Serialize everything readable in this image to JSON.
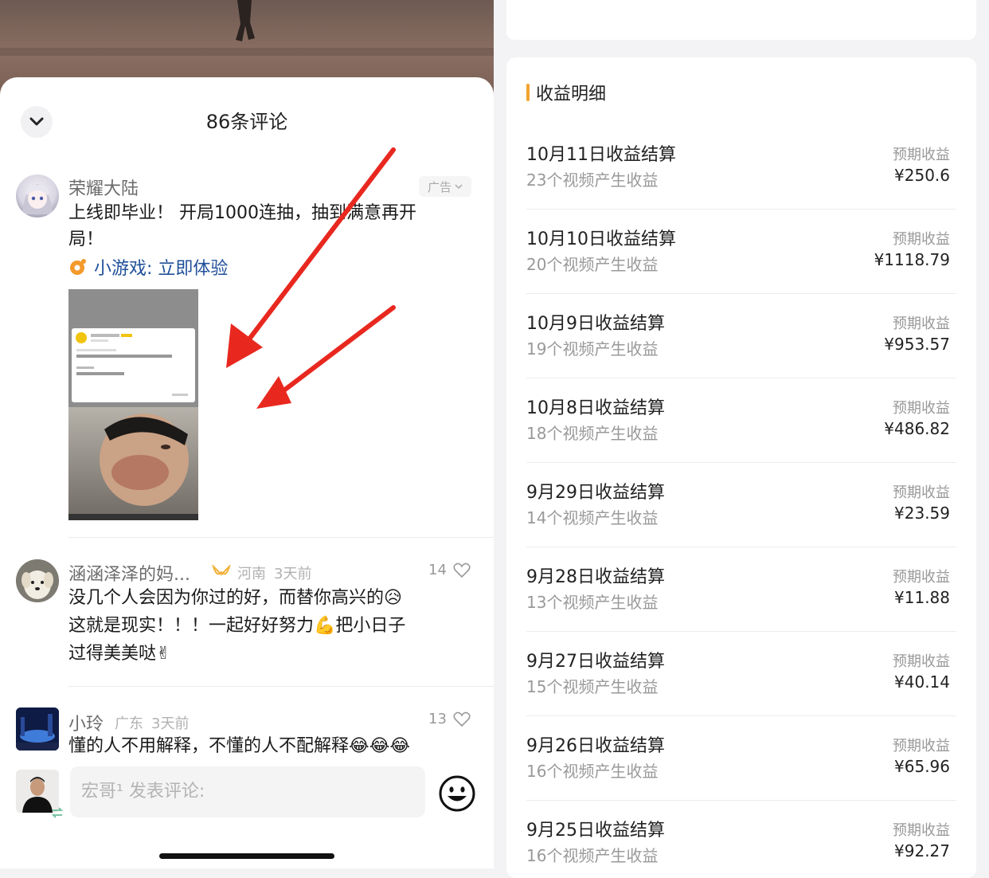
{
  "comments_panel": {
    "title": "86条评论",
    "ad_comment": {
      "username": "荣耀大陆",
      "ad_label": "广告",
      "text_line1": "上线即毕业！ 开局1000连抽，抽到满意再开",
      "text_line2": "局！",
      "game_link": "小游戏: 立即体验"
    },
    "comments": [
      {
        "username": "涵涵泽泽的妈...",
        "location": "河南",
        "time": "3天前",
        "likes": "14",
        "line1": "没几个人会因为你过的好，而替你高兴的😥",
        "line2": "这就是现实！！！一起好好努力💪把小日子",
        "line3": "过得美美哒✌"
      },
      {
        "username": "小玲",
        "location": "广东",
        "time": "3天前",
        "likes": "13",
        "line1": "懂的人不用解释，不懂的人不配解释😂😂😂"
      }
    ],
    "input": {
      "placeholder": "宏哥¹ 发表评论:"
    }
  },
  "earnings": {
    "title": "收益明细",
    "accent_color": "#f2a32f",
    "items": [
      {
        "title": "10月11日收益结算",
        "sub": "23个视频产生收益",
        "label": "预期收益",
        "amount": "¥250.6"
      },
      {
        "title": "10月10日收益结算",
        "sub": "20个视频产生收益",
        "label": "预期收益",
        "amount": "¥1118.79"
      },
      {
        "title": "10月9日收益结算",
        "sub": "19个视频产生收益",
        "label": "预期收益",
        "amount": "¥953.57"
      },
      {
        "title": "10月8日收益结算",
        "sub": "18个视频产生收益",
        "label": "预期收益",
        "amount": "¥486.82"
      },
      {
        "title": "9月29日收益结算",
        "sub": "14个视频产生收益",
        "label": "预期收益",
        "amount": "¥23.59"
      },
      {
        "title": "9月28日收益结算",
        "sub": "13个视频产生收益",
        "label": "预期收益",
        "amount": "¥11.88"
      },
      {
        "title": "9月27日收益结算",
        "sub": "15个视频产生收益",
        "label": "预期收益",
        "amount": "¥40.14"
      },
      {
        "title": "9月26日收益结算",
        "sub": "16个视频产生收益",
        "label": "预期收益",
        "amount": "¥65.96"
      },
      {
        "title": "9月25日收益结算",
        "sub": "16个视频产生收益",
        "label": "预期收益",
        "amount": "¥92.27"
      }
    ]
  }
}
